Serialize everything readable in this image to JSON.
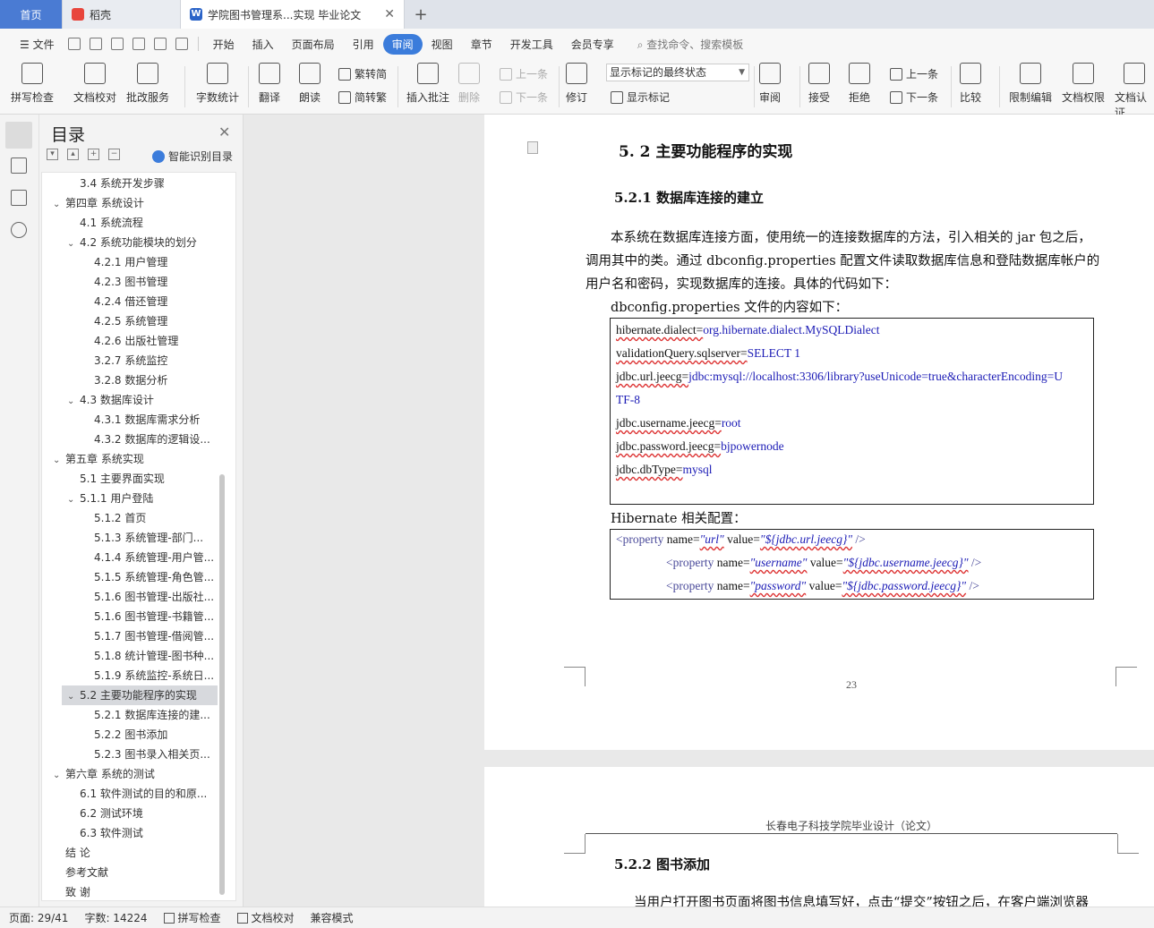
{
  "tabs": {
    "home": "首页",
    "wps": "稻壳",
    "doc": "学院图书管理系...实现 毕业论文"
  },
  "menu": {
    "file": "文件",
    "items": [
      "开始",
      "插入",
      "页面布局",
      "引用",
      "审阅",
      "视图",
      "章节",
      "开发工具",
      "会员专享"
    ],
    "active": "审阅",
    "search": "查找命令、搜索模板"
  },
  "ribbon": {
    "spell": "拼写检查",
    "docproof": "文档校对",
    "batch": "批改服务",
    "wordcount": "字数统计",
    "translate": "翻译",
    "read": "朗读",
    "trad": "繁转简",
    "simp": "简转繁",
    "insert_comment": "插入批注",
    "delete": "删除",
    "prev_comment": "上一条",
    "next_comment": "下一条",
    "revise": "修订",
    "markup_state": "显示标记的最终状态",
    "show_markup": "显示标记",
    "review": "审阅",
    "accept": "接受",
    "reject": "拒绝",
    "prev": "上一条",
    "next": "下一条",
    "compare": "比较",
    "restrict": "限制编辑",
    "permission": "文档权限",
    "cert": "文档认证"
  },
  "toc": {
    "title": "目录",
    "smart": "智能识别目录",
    "items": [
      {
        "text": "3.4  系统开发步骤",
        "level": 2,
        "caret": ""
      },
      {
        "text": "第四章      系统设计",
        "level": 1,
        "caret": "v"
      },
      {
        "text": "4.1 系统流程",
        "level": 2,
        "caret": ""
      },
      {
        "text": "4.2  系统功能模块的划分",
        "level": 2,
        "caret": "v"
      },
      {
        "text": "4.2.1 用户管理",
        "level": 3,
        "caret": ""
      },
      {
        "text": "4.2.3  图书管理",
        "level": 3,
        "caret": ""
      },
      {
        "text": "4.2.4  借还管理",
        "level": 3,
        "caret": ""
      },
      {
        "text": "4.2.5  系统管理",
        "level": 3,
        "caret": ""
      },
      {
        "text": "4.2.6  出版社管理",
        "level": 3,
        "caret": ""
      },
      {
        "text": "3.2.7  系统监控",
        "level": 3,
        "caret": ""
      },
      {
        "text": "3.2.8  数据分析",
        "level": 3,
        "caret": ""
      },
      {
        "text": "4.3 数据库设计",
        "level": 2,
        "caret": "v"
      },
      {
        "text": "4.3.1 数据库需求分析",
        "level": 3,
        "caret": ""
      },
      {
        "text": "4.3.2 数据库的逻辑设...",
        "level": 3,
        "caret": ""
      },
      {
        "text": "第五章      系统实现",
        "level": 1,
        "caret": "v"
      },
      {
        "text": "5.1 主要界面实现",
        "level": 2,
        "caret": ""
      },
      {
        "text": "5.1.1 用户登陆",
        "level": 2,
        "caret": "v"
      },
      {
        "text": "5.1.2  首页",
        "level": 3,
        "caret": ""
      },
      {
        "text": "5.1.3  系统管理-部门...",
        "level": 3,
        "caret": ""
      },
      {
        "text": "4.1.4 系统管理-用户管...",
        "level": 3,
        "caret": ""
      },
      {
        "text": "5.1.5 系统管理-角色管...",
        "level": 3,
        "caret": ""
      },
      {
        "text": "5.1.6 图书管理-出版社...",
        "level": 3,
        "caret": ""
      },
      {
        "text": "5.1.6 图书管理-书籍管...",
        "level": 3,
        "caret": ""
      },
      {
        "text": "5.1.7 图书管理-借阅管...",
        "level": 3,
        "caret": ""
      },
      {
        "text": "5.1.8 统计管理-图书种...",
        "level": 3,
        "caret": ""
      },
      {
        "text": "5.1.9 系统监控-系统日...",
        "level": 3,
        "caret": ""
      },
      {
        "text": "5.2 主要功能程序的实现",
        "level": 2,
        "caret": "v",
        "selected": true
      },
      {
        "text": "5.2.1  数据库连接的建...",
        "level": 3,
        "caret": ""
      },
      {
        "text": "5.2.2 图书添加",
        "level": 3,
        "caret": ""
      },
      {
        "text": "5.2.3 图书录入相关页...",
        "level": 3,
        "caret": ""
      },
      {
        "text": "第六章      系统的测试",
        "level": 1,
        "caret": "v"
      },
      {
        "text": "6.1  软件测试的目的和原...",
        "level": 2,
        "caret": ""
      },
      {
        "text": "6.2  测试环境",
        "level": 2,
        "caret": ""
      },
      {
        "text": "6.3  软件测试",
        "level": 2,
        "caret": ""
      },
      {
        "text": "结      论",
        "level": 1,
        "caret": ""
      },
      {
        "text": "参考文献",
        "level": 1,
        "caret": ""
      },
      {
        "text": "致      谢",
        "level": 1,
        "caret": ""
      }
    ]
  },
  "doc": {
    "h2": "5. 2 主要功能程序的实现",
    "h3": "5.2.1  数据库连接的建立",
    "para1": "本系统在数据库连接方面，使用统一的连接数据库的方法，引入相关的 jar 包之后，",
    "para2": "调用其中的类。通过 dbconfig.properties 配置文件读取数据库信息和登陆数据库帐户的",
    "para3": "用户名和密码，实现数据库的连接。具体的代码如下：",
    "para4": "dbconfig.properties 文件的内容如下：",
    "code1": [
      [
        "hibernate.dialect=",
        "org.hibernate.dialect.MySQLDialect"
      ],
      [
        "validationQuery.sqlserver=",
        "SELECT 1"
      ],
      [
        "jdbc.url.jeecg=",
        "jdbc:mysql://localhost:3306/library?useUnicode=true&characterEncoding=U"
      ],
      [
        "",
        "TF-8"
      ],
      [
        "jdbc.username.jeecg=",
        "root"
      ],
      [
        "jdbc.password.jeecg=",
        "bjpowernode"
      ],
      [
        "jdbc.dbType=",
        "mysql"
      ]
    ],
    "para5": "Hibernate 相关配置：",
    "code2": [
      {
        "tag": "<property ",
        "n": "name=",
        "nv": "\"url\"",
        "v": " value=",
        "vv": "\"${jdbc.url.jeecg}\"",
        "end": " />"
      },
      {
        "tag": "<property ",
        "n": "name=",
        "nv": "\"username\"",
        "v": " value=",
        "vv": "\"${jdbc.username.jeecg}\"",
        "end": " />"
      },
      {
        "tag": "<property ",
        "n": "name=",
        "nv": "\"password\"",
        "v": " value=",
        "vv": "\"${jdbc.password.jeecg}\"",
        "end": " />"
      }
    ],
    "page_number": "23",
    "header2": "长春电子科技学院毕业设计（论文）",
    "h3_2": "5.2.2 图书添加",
    "para6": "当用户打开图书页面将图书信息填写好，点击“提交”按钮之后，在客户端浏览器"
  },
  "status": {
    "page": "页面: 29/41",
    "words": "字数: 14224",
    "spell": "拼写检查",
    "proof": "文档校对",
    "compat": "兼容模式"
  }
}
